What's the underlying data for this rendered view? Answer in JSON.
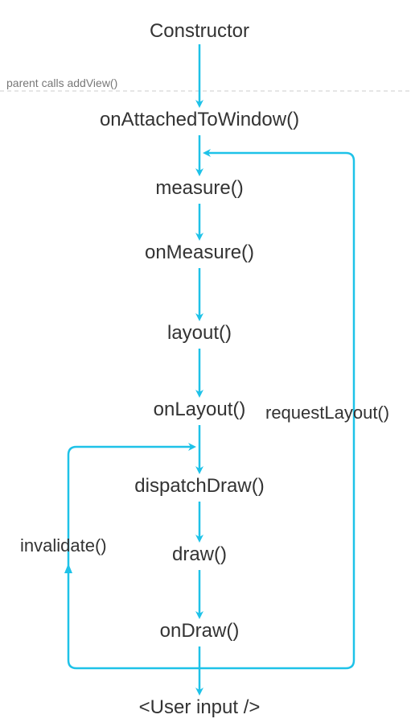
{
  "diagram": {
    "nodes": {
      "constructor": "Constructor",
      "onAttached": "onAttachedToWindow()",
      "measure": "measure()",
      "onMeasure": "onMeasure()",
      "layout": "layout()",
      "onLayout": "onLayout()",
      "dispatchDraw": "dispatchDraw()",
      "draw": "draw()",
      "onDraw": "onDraw()",
      "userInput": "<User input />"
    },
    "edges": {
      "invalidate": "invalidate()",
      "requestLayout": "requestLayout()"
    },
    "annotations": {
      "parentCalls": "parent calls addView()"
    },
    "colors": {
      "accent": "#1EC2E8"
    }
  }
}
